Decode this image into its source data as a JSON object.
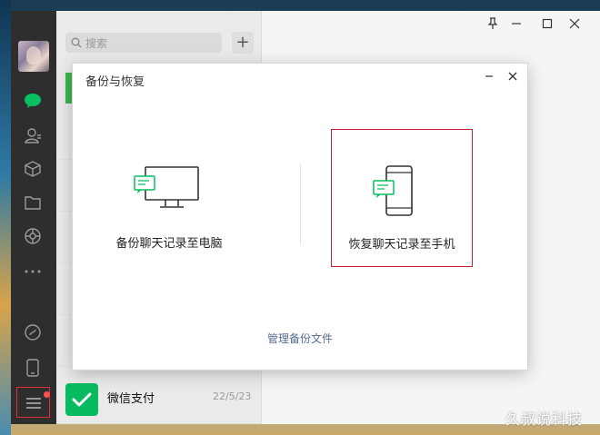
{
  "search": {
    "placeholder": "搜索"
  },
  "chat_list": {
    "items": [
      {
        "name": "微信支付",
        "date": "22/5/23"
      }
    ]
  },
  "dialog": {
    "title": "备份与恢复",
    "backup_label": "备份聊天记录至电脑",
    "restore_label": "恢复聊天记录至手机",
    "manage_link": "管理备份文件"
  },
  "colors": {
    "accent": "#09bb60",
    "highlight_border": "#c8202c",
    "link": "#576b95",
    "sidebar": "#2e2e2e"
  },
  "watermark": "久叔说科技"
}
